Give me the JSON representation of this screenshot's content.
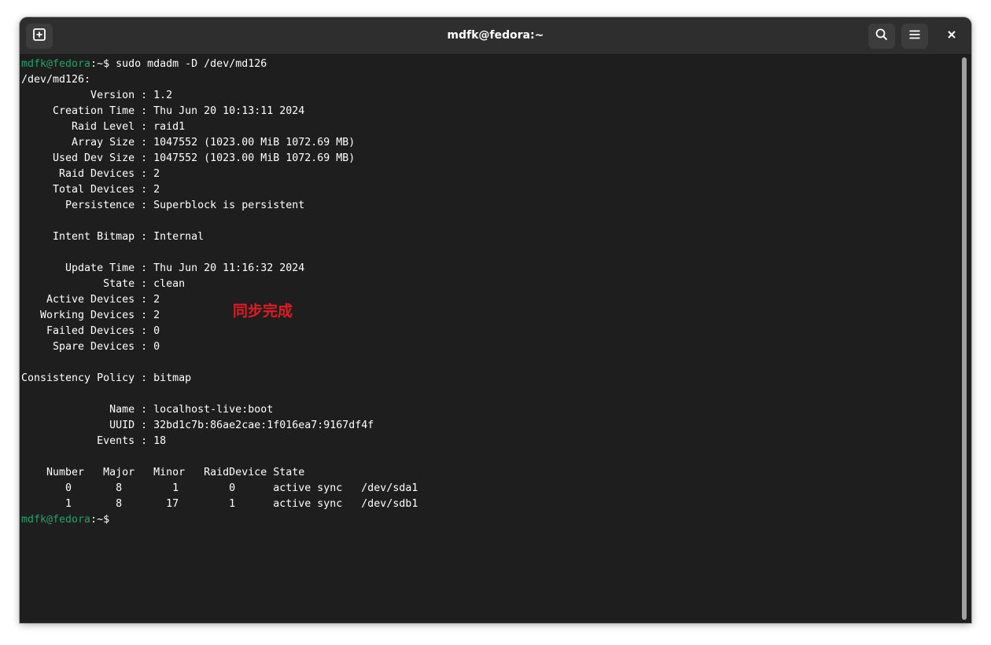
{
  "window": {
    "title": "mdfk@fedora:~"
  },
  "toolbar": {
    "new_tab_icon": "plus-square-icon",
    "search_icon": "magnifier-icon",
    "menu_icon": "hamburger-icon",
    "close_icon": "close-x-icon"
  },
  "terminal": {
    "prompt": {
      "user_host": "mdfk@fedora",
      "path_symbol": ":~$"
    },
    "command": " sudo mdadm -D /dev/md126",
    "output": [
      "/dev/md126:",
      "           Version : 1.2",
      "     Creation Time : Thu Jun 20 10:13:11 2024",
      "        Raid Level : raid1",
      "        Array Size : 1047552 (1023.00 MiB 1072.69 MB)",
      "     Used Dev Size : 1047552 (1023.00 MiB 1072.69 MB)",
      "      Raid Devices : 2",
      "     Total Devices : 2",
      "       Persistence : Superblock is persistent",
      "",
      "     Intent Bitmap : Internal",
      "",
      "       Update Time : Thu Jun 20 11:16:32 2024",
      "             State : clean",
      "    Active Devices : 2",
      "   Working Devices : 2",
      "    Failed Devices : 0",
      "     Spare Devices : 0",
      "",
      "Consistency Policy : bitmap",
      "",
      "              Name : localhost-live:boot",
      "              UUID : 32bd1c7b:86ae2cae:1f016ea7:9167df4f",
      "            Events : 18",
      "",
      "    Number   Major   Minor   RaidDevice State",
      "       0       8        1        0      active sync   /dev/sda1",
      "       1       8       17        1      active sync   /dev/sdb1"
    ]
  },
  "annotation": {
    "text": "同步完成",
    "color": "#e01b24"
  },
  "colors": {
    "prompt_user": "#26a269",
    "terminal_bg": "#1e1e1e",
    "titlebar_bg": "#2e2e2e"
  }
}
